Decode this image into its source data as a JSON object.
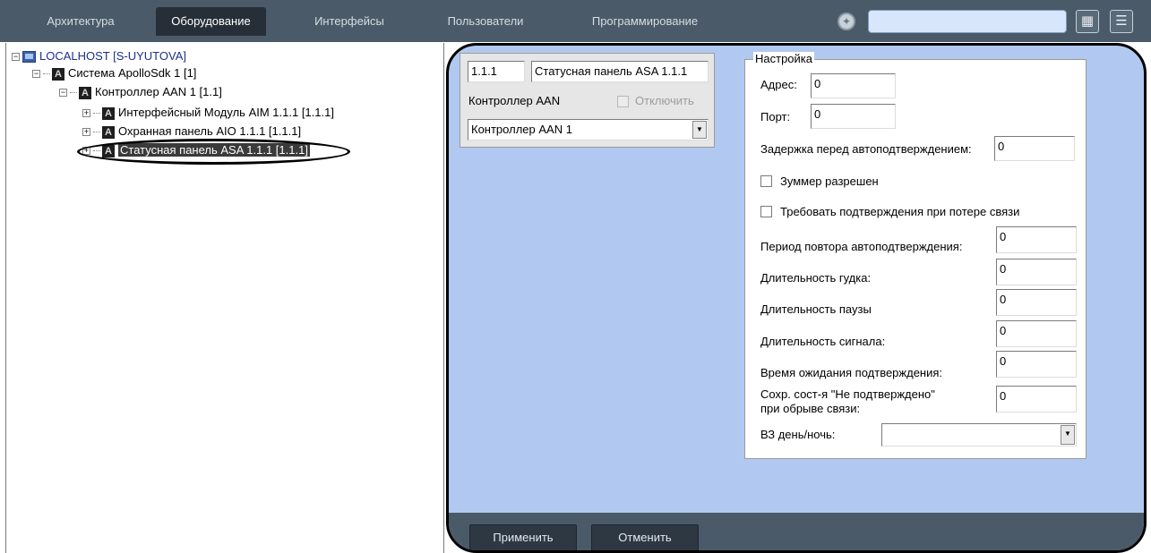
{
  "tabs": [
    {
      "label": "Архитектура"
    },
    {
      "label": "Оборудование"
    },
    {
      "label": "Интерфейсы"
    },
    {
      "label": "Пользователи"
    },
    {
      "label": "Программирование"
    }
  ],
  "search": {
    "value": ""
  },
  "tree": {
    "root": "LOCALHOST [S-UYUTOVA]",
    "system": "Система ApolloSdk 1 [1]",
    "controller": "Контроллер AAN 1 [1.1]",
    "child1": "Интерфейсный Модуль AIM 1.1.1 [1.1.1]",
    "child2": "Охранная панель AIO 1.1.1 [1.1.1]",
    "child3": "Статусная панель ASA 1.1.1 [1.1.1]"
  },
  "object": {
    "id": "1.1.1",
    "name": "Статусная панель ASA 1.1.1",
    "parent_type_label": "Контроллер AAN",
    "disable_label": "Отключить",
    "parent_selected": "Контроллер AAN 1"
  },
  "settings": {
    "group_title": "Настройка",
    "address_label": "Адрес:",
    "address_value": "0",
    "port_label": "Порт:",
    "port_value": "0",
    "delay_label": "Задержка перед автоподтверждением:",
    "delay_value": "0",
    "buzzer_label": "Зуммер разрешен",
    "require_ack_label": "Требовать подтверждения при потере связи",
    "repeat_period_label": "Период повтора автоподтверждения:",
    "repeat_period_value": "0",
    "beep_duration_label": "Длительность гудка:",
    "beep_duration_value": "0",
    "pause_duration_label": "Длительность паузы",
    "pause_duration_value": "0",
    "signal_duration_label": "Длительность сигнала:",
    "signal_duration_value": "0",
    "ack_wait_label": "Время ожидания подтверждения:",
    "ack_wait_value": "0",
    "keep_state_label_line1": "Сохр. сост-я \"Не подтверждено\"",
    "keep_state_label_line2": "при обрыве связи:",
    "keep_state_value": "0",
    "daynight_label": "ВЗ день/ночь:",
    "daynight_value": ""
  },
  "buttons": {
    "apply": "Применить",
    "cancel": "Отменить"
  }
}
